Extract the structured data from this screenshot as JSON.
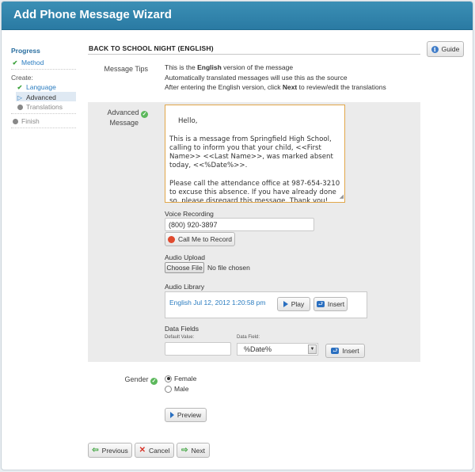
{
  "window": {
    "title": "Add Phone Message Wizard"
  },
  "sidebar": {
    "progress_label": "Progress",
    "method_label": "Method",
    "create_label": "Create:",
    "language_label": "Language",
    "advanced_label": "Advanced",
    "translations_label": "Translations",
    "finish_label": "Finish"
  },
  "section": {
    "title": "BACK TO SCHOOL NIGHT (ENGLISH)"
  },
  "guide_button": "Guide",
  "tips": {
    "label": "Message Tips",
    "line1_pre": "This is the ",
    "line1_bold": "English",
    "line1_post": " version of the message",
    "line2": "Automatically translated messages will use this as the source",
    "line3_pre": "After entering the English version, click ",
    "line3_bold": "Next",
    "line3_post": " to review/edit the translations"
  },
  "advanced_message": {
    "label_line1": "Advanced",
    "label_line2": "Message",
    "text": "Hello,\n\nThis is a message from Springfield High School, calling to inform you that your child, <<First Name>> <<Last Name>>, was marked absent today, <<%Date%>>.\n\nPlease call the attendance office at 987-654-3210 to excuse this absence. If you have already done so, please disregard this message. Thank you!"
  },
  "voice_recording": {
    "label": "Voice Recording",
    "phone": "(800) 920-3897",
    "call_button": "Call Me to Record"
  },
  "audio_upload": {
    "label": "Audio Upload",
    "choose_button": "Choose File",
    "status": "No file chosen"
  },
  "audio_library": {
    "label": "Audio Library",
    "item": "English Jul 12, 2012 1:20:58 pm",
    "play_button": "Play",
    "insert_button": "Insert"
  },
  "data_fields": {
    "label": "Data Fields",
    "default_value_label": "Default Value:",
    "default_value": "",
    "data_field_label": "Data Field:",
    "selected": "%Date%",
    "insert_button": "Insert"
  },
  "gender": {
    "label": "Gender",
    "options": [
      "Female",
      "Male"
    ],
    "selected": "Female"
  },
  "preview_button": "Preview",
  "footer": {
    "previous": "Previous",
    "cancel": "Cancel",
    "next": "Next"
  }
}
